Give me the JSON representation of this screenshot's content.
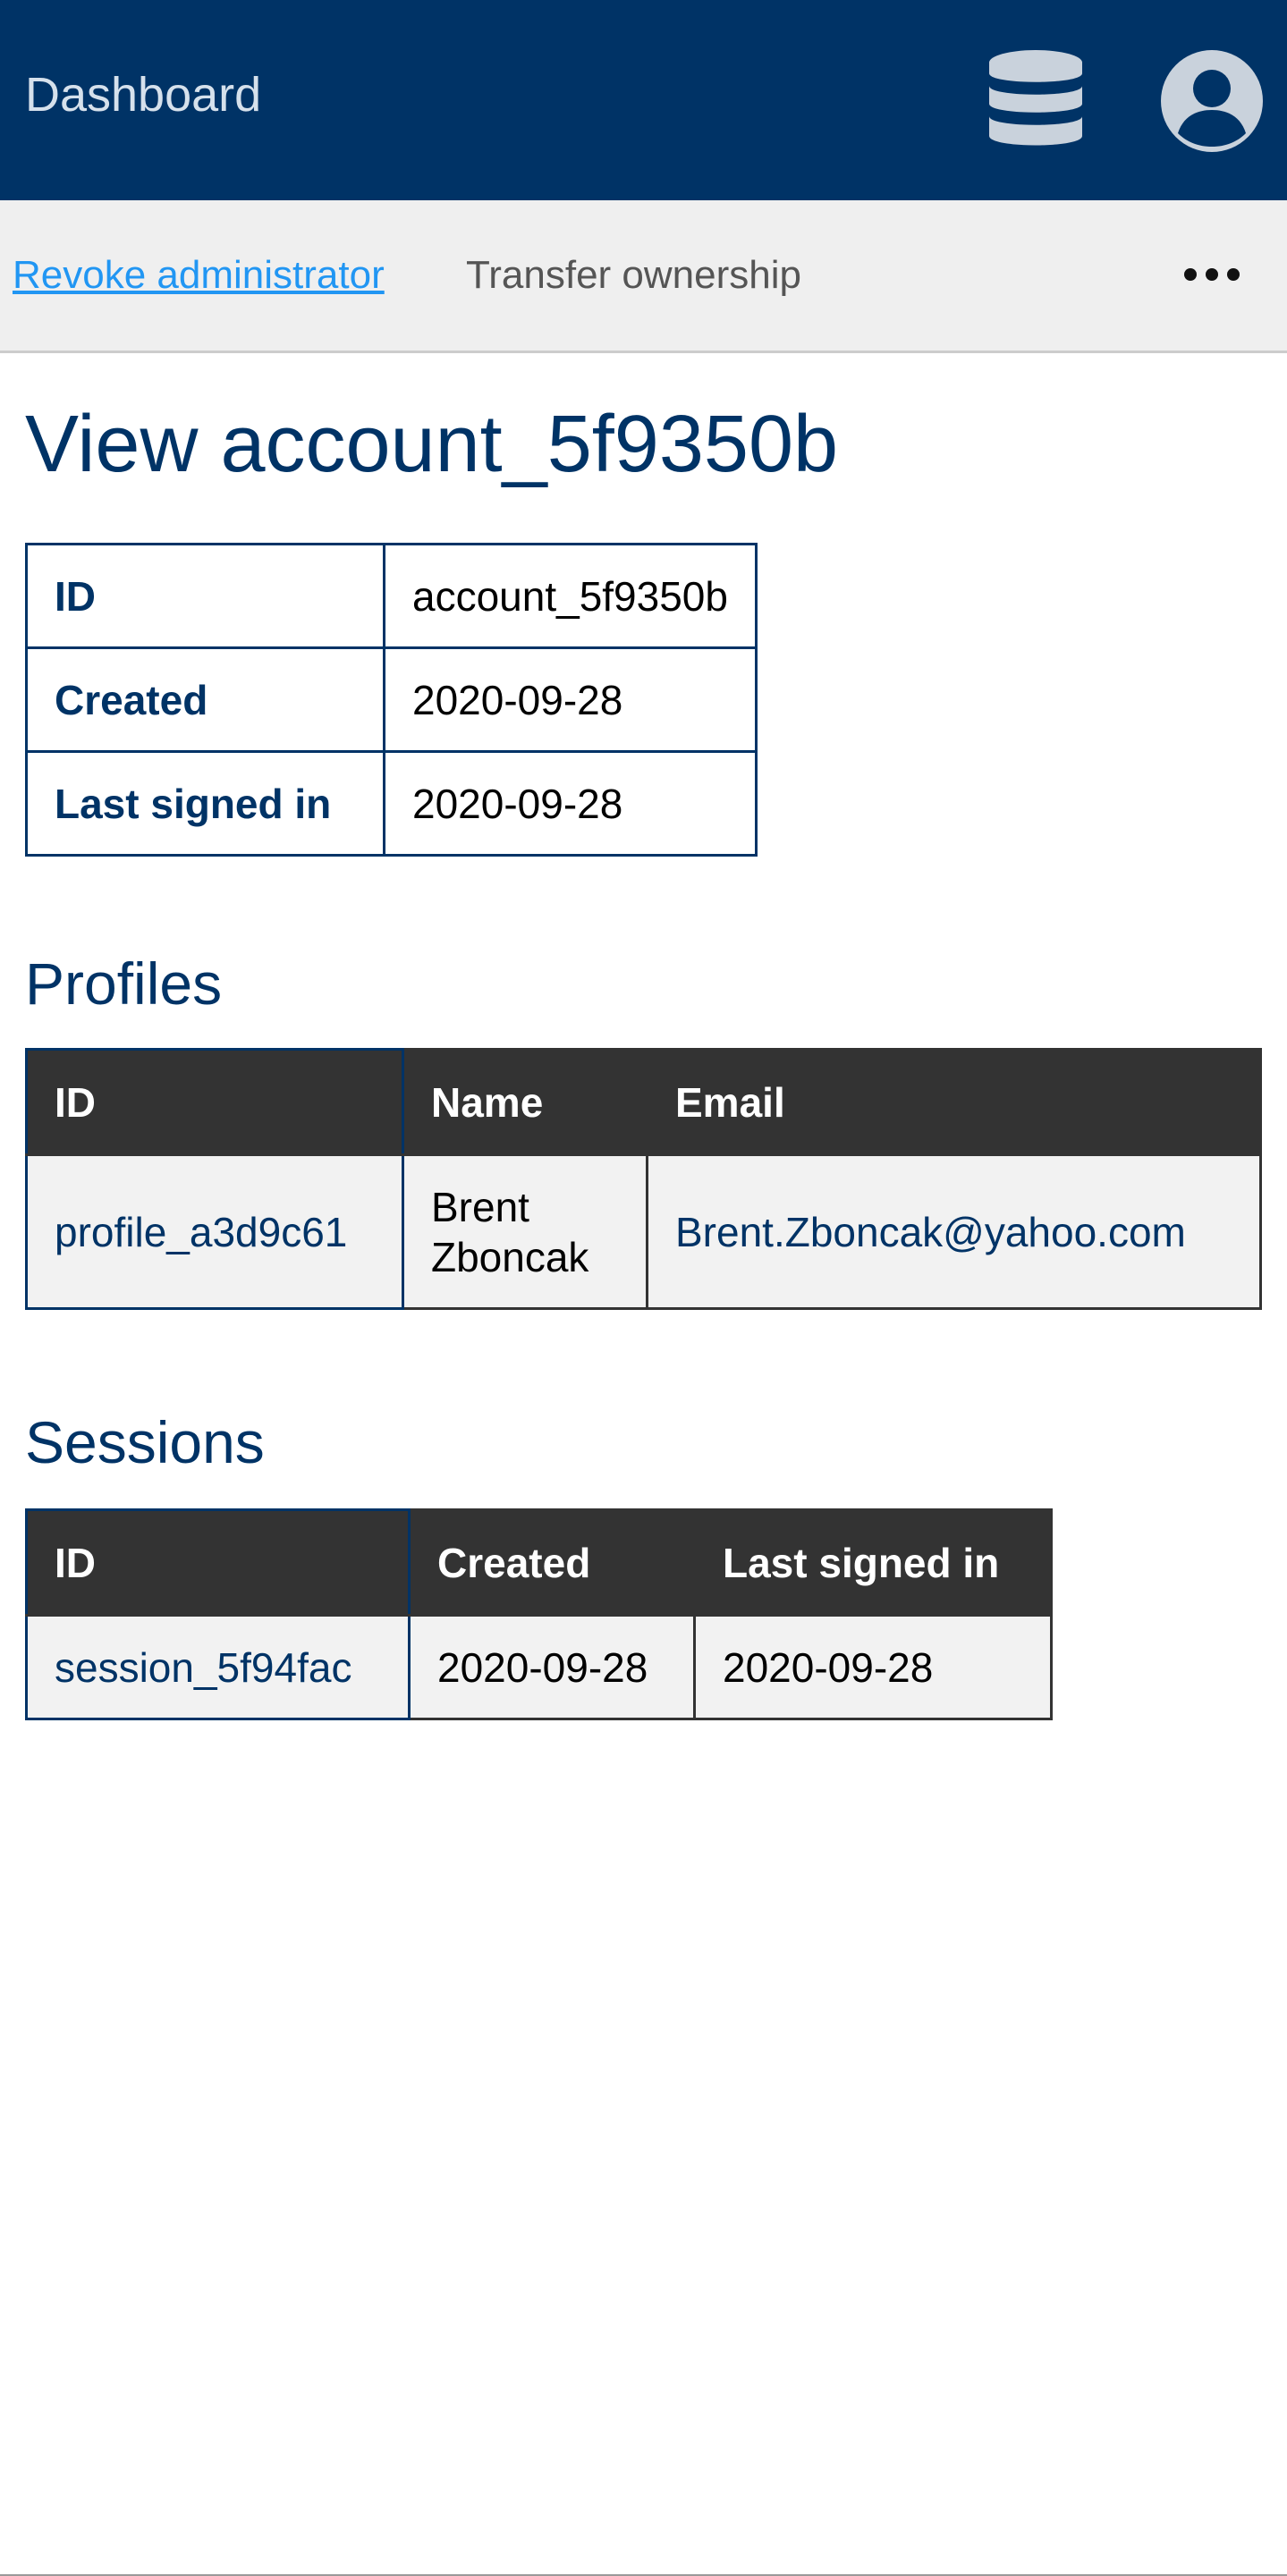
{
  "header": {
    "title": "Dashboard",
    "icons": [
      "database-icon",
      "user-circle-icon"
    ],
    "background_color": "#003366"
  },
  "actions": {
    "revoke_label": "Revoke administrator",
    "transfer_label": "Transfer ownership",
    "more_icon": "more-horizontal-icon",
    "link_color": "#2196f3"
  },
  "account": {
    "title": "View account_5f9350b",
    "details": [
      {
        "label": "ID",
        "value": "account_5f9350b"
      },
      {
        "label": "Created",
        "value": "2020-09-28"
      },
      {
        "label": "Last signed in",
        "value": "2020-09-28"
      }
    ]
  },
  "profiles": {
    "title": "Profiles",
    "columns": [
      "ID",
      "Name",
      "Email"
    ],
    "rows": [
      {
        "id": "profile_a3d9c61",
        "name": "Brent Zboncak",
        "email": "Brent.Zboncak@yahoo.com"
      }
    ]
  },
  "sessions": {
    "title": "Sessions",
    "columns": [
      "ID",
      "Created",
      "Last signed in"
    ],
    "rows": [
      {
        "id": "session_5f94fac",
        "created": "2020-09-28",
        "last_signed_in": "2020-09-28"
      }
    ]
  }
}
